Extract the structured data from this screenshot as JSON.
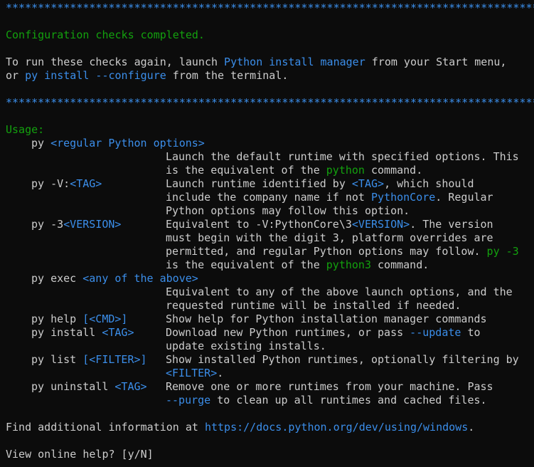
{
  "stars": "*************************************************************************************",
  "completed": "Configuration checks completed.",
  "rerun": {
    "prefix": "To run these checks again, launch ",
    "manager": "Python install manager",
    "suffix": " from your Start menu,",
    "or": "or ",
    "cmd": "py install --configure",
    "tail": " from the terminal."
  },
  "usage_label": "Usage:",
  "usage": [
    {
      "cmd_plain": "py ",
      "cmd_arg": "<regular Python options>"
    },
    {
      "desc": [
        {
          "t": "Launch the default runtime with specified options. This"
        }
      ]
    },
    {
      "desc": [
        {
          "t": "is the equivalent of the "
        },
        {
          "g": "python"
        },
        {
          "t": " command."
        }
      ]
    },
    {
      "cmd_plain": "py -V:",
      "cmd_arg": "<TAG>",
      "desc": [
        {
          "t": "Launch runtime identified by "
        },
        {
          "b": "<TAG>"
        },
        {
          "t": ", which should"
        }
      ]
    },
    {
      "desc": [
        {
          "t": "include the company name if not "
        },
        {
          "b": "PythonCore"
        },
        {
          "t": ". Regular"
        }
      ]
    },
    {
      "desc": [
        {
          "t": "Python options may follow this option."
        }
      ]
    },
    {
      "cmd_plain": "py -3",
      "cmd_arg": "<VERSION>",
      "desc": [
        {
          "t": "Equivalent to -V:PythonCore\\3"
        },
        {
          "b": "<VERSION>"
        },
        {
          "t": ". The version"
        }
      ]
    },
    {
      "desc": [
        {
          "t": "must begin with the digit 3, platform overrides are"
        }
      ]
    },
    {
      "desc": [
        {
          "t": "permitted, and regular Python options may follow. "
        },
        {
          "g": "py -3"
        }
      ]
    },
    {
      "desc": [
        {
          "t": "is the equivalent of the "
        },
        {
          "g": "python3"
        },
        {
          "t": " command."
        }
      ]
    },
    {
      "cmd_plain": "py exec ",
      "cmd_arg": "<any of the above>"
    },
    {
      "desc": [
        {
          "t": "Equivalent to any of the above launch options, and the"
        }
      ]
    },
    {
      "desc": [
        {
          "t": "requested runtime will be installed if needed."
        }
      ]
    },
    {
      "cmd_plain": "py help ",
      "cmd_arg": "[<CMD>]",
      "desc": [
        {
          "t": "Show help for Python installation manager commands"
        }
      ]
    },
    {
      "cmd_plain": "py install ",
      "cmd_arg": "<TAG>",
      "desc": [
        {
          "t": "Download new Python runtimes, or pass "
        },
        {
          "b": "--update"
        },
        {
          "t": " to"
        }
      ]
    },
    {
      "desc": [
        {
          "t": "update existing installs."
        }
      ]
    },
    {
      "cmd_plain": "py list ",
      "cmd_arg": "[<FILTER>]",
      "desc": [
        {
          "t": "Show installed Python runtimes, optionally filtering by"
        }
      ]
    },
    {
      "desc": [
        {
          "b": "<FILTER>"
        },
        {
          "t": "."
        }
      ]
    },
    {
      "cmd_plain": "py uninstall ",
      "cmd_arg": "<TAG>",
      "desc": [
        {
          "t": "Remove one or more runtimes from your machine. Pass"
        }
      ]
    },
    {
      "desc": [
        {
          "b": "--purge"
        },
        {
          "t": " to clean up all runtimes and cached files."
        }
      ]
    }
  ],
  "info": {
    "prefix": "Find additional information at ",
    "url": "https://docs.python.org/dev/using/windows",
    "suffix": "."
  },
  "prompt": "View online help? [y/N]",
  "colors": {
    "background": "#0c0c0c",
    "text": "#cccccc",
    "accent_blue": "#3b8eea",
    "accent_green": "#16c60c"
  }
}
